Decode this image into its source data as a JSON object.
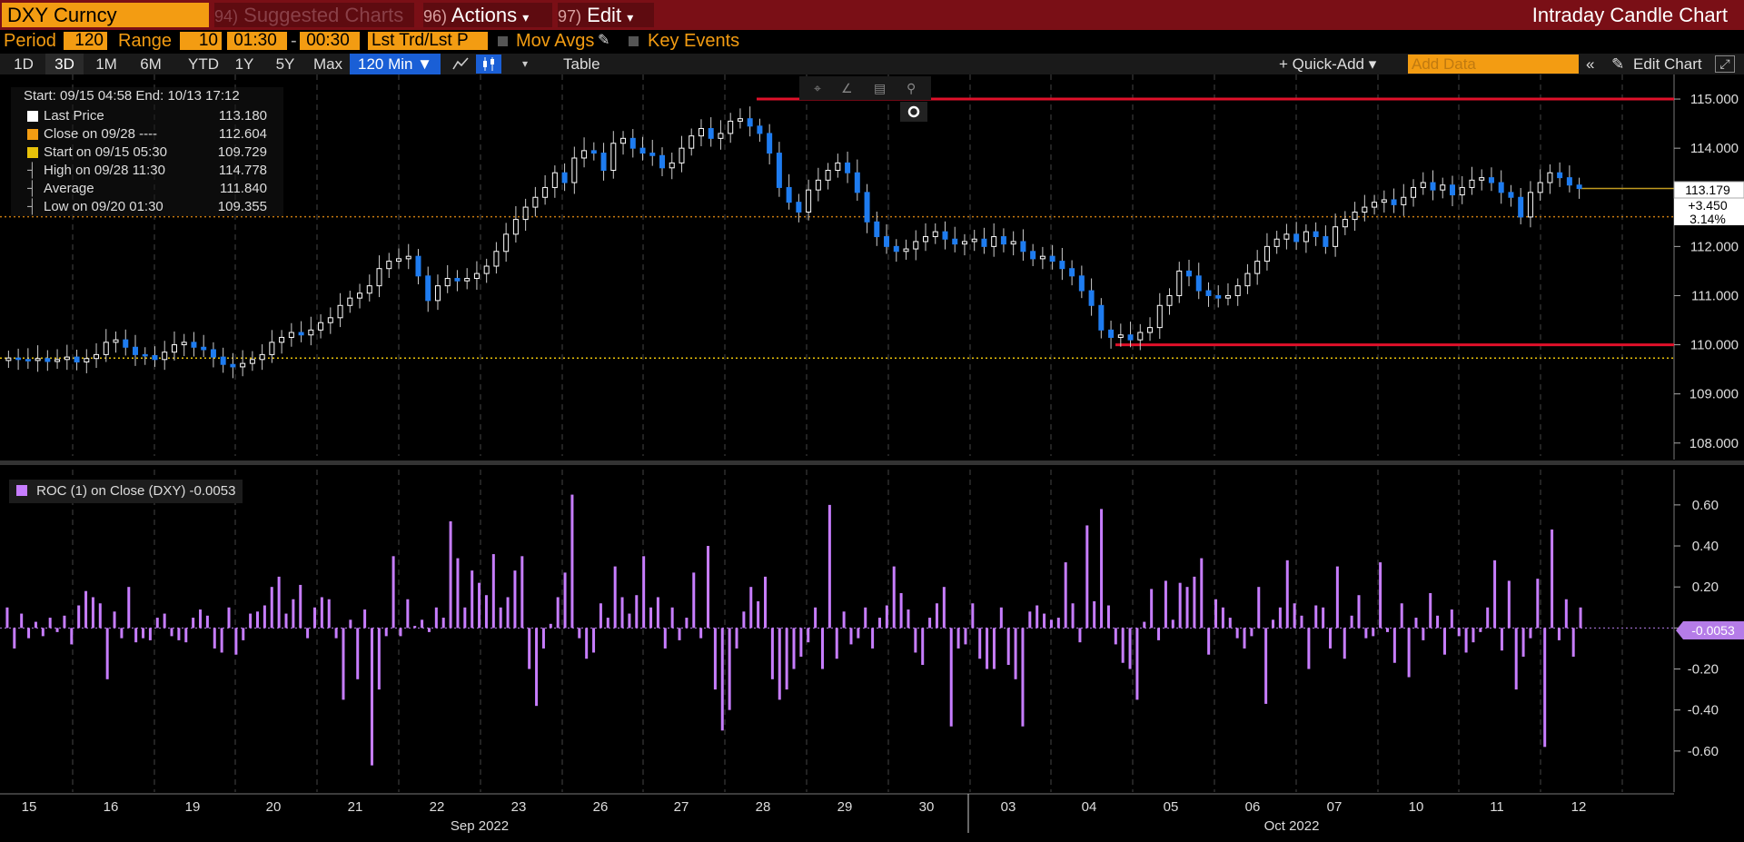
{
  "toolbar": {
    "ticker": "DXY Curncy",
    "suggested_num": "94)",
    "suggested_label": "Suggested Charts",
    "actions_num": "96)",
    "actions_label": "Actions",
    "edit_num": "97)",
    "edit_label": "Edit",
    "chart_title": "Intraday Candle Chart"
  },
  "settings": {
    "period_label": "Period",
    "period_value": "120",
    "range_label": "Range",
    "range_value": "10",
    "time_from": "01:30",
    "time_to": "00:30",
    "trade_mode": "Lst Trd/Lst P",
    "mov_avgs": "Mov Avgs",
    "key_events": "Key Events"
  },
  "ranges": [
    "1D",
    "3D",
    "1M",
    "6M",
    "YTD",
    "1Y",
    "5Y",
    "Max"
  ],
  "selected_range": "3D",
  "interval": "120 Min ▼",
  "table_label": "Table",
  "quick_add": "+ Quick-Add ▾",
  "add_data_placeholder": "Add Data",
  "edit_chart": "Edit Chart",
  "legend": {
    "range_line": "Start: 09/15 04:58 End: 10/13 17:12",
    "rows": [
      {
        "label": "Last Price",
        "value": "113.180",
        "color": "#ffffff"
      },
      {
        "label": "Close on 09/28 ----",
        "value": "112.604",
        "color": "#f39c12"
      },
      {
        "label": "Start on 09/15 05:30",
        "value": "109.729",
        "color": "#e8c20a"
      },
      {
        "label": "High on 09/28 11:30",
        "value": "114.778",
        "color": ""
      },
      {
        "label": "Average",
        "value": "111.840",
        "color": ""
      },
      {
        "label": "Low on 09/20 01:30",
        "value": "109.355",
        "color": ""
      }
    ]
  },
  "price_tag": {
    "value": "113.179",
    "change": "+3.450",
    "pct": "3.14%"
  },
  "roc_legend": "ROC (1)  on Close (DXY) -0.0053",
  "roc_tag": "-0.0053",
  "chart_data": [
    {
      "type": "candlestick",
      "y_ticks": [
        "115.000",
        "114.000",
        "113.000",
        "112.000",
        "111.000",
        "110.000",
        "109.000",
        "108.000"
      ],
      "ylim": [
        107.7,
        115.5
      ],
      "days": [
        "15",
        "16",
        "19",
        "20",
        "21",
        "22",
        "23",
        "26",
        "27",
        "28",
        "29",
        "30",
        "03",
        "04",
        "05",
        "06",
        "07",
        "10",
        "11",
        "12"
      ],
      "month_labels": [
        "Sep 2022",
        "Oct 2022"
      ],
      "reference_lines": {
        "resistance": 115.0,
        "support": 110.0,
        "close_0928": 112.604,
        "start": 109.729,
        "last": 113.18
      },
      "close_series": [
        109.73,
        109.7,
        109.68,
        109.72,
        109.66,
        109.7,
        109.75,
        109.65,
        109.72,
        109.8,
        110.05,
        110.1,
        109.95,
        109.8,
        109.78,
        109.7,
        109.85,
        110.0,
        110.05,
        109.95,
        109.9,
        109.75,
        109.6,
        109.55,
        109.62,
        109.7,
        109.8,
        110.05,
        110.15,
        110.25,
        110.2,
        110.3,
        110.45,
        110.55,
        110.8,
        110.95,
        111.05,
        111.2,
        111.55,
        111.7,
        111.75,
        111.8,
        111.4,
        110.9,
        111.2,
        111.35,
        111.3,
        111.35,
        111.45,
        111.6,
        111.9,
        112.25,
        112.55,
        112.8,
        113.0,
        113.2,
        113.5,
        113.3,
        113.8,
        113.95,
        113.9,
        113.55,
        114.1,
        114.2,
        114.0,
        113.9,
        113.85,
        113.6,
        113.7,
        114.0,
        114.25,
        114.4,
        114.2,
        114.3,
        114.55,
        114.6,
        114.45,
        114.3,
        113.9,
        113.2,
        112.9,
        112.7,
        113.15,
        113.35,
        113.55,
        113.7,
        113.5,
        113.1,
        112.5,
        112.2,
        112.0,
        111.9,
        111.95,
        112.1,
        112.2,
        112.3,
        112.15,
        112.05,
        112.1,
        112.15,
        112.0,
        112.2,
        112.05,
        112.1,
        111.9,
        111.75,
        111.8,
        111.7,
        111.55,
        111.4,
        111.1,
        110.8,
        110.3,
        110.15,
        110.2,
        110.1,
        110.25,
        110.35,
        110.8,
        111.0,
        111.5,
        111.4,
        111.1,
        111.0,
        110.95,
        111.0,
        111.2,
        111.45,
        111.7,
        112.0,
        112.15,
        112.25,
        112.1,
        112.3,
        112.2,
        112.0,
        112.4,
        112.55,
        112.7,
        112.8,
        112.9,
        112.95,
        112.85,
        113.0,
        113.2,
        113.3,
        113.15,
        113.25,
        113.05,
        113.2,
        113.35,
        113.4,
        113.3,
        113.1,
        113.0,
        112.6,
        113.1,
        113.3,
        113.5,
        113.4,
        113.25,
        113.18
      ]
    },
    {
      "type": "bar",
      "name": "ROC (1) on Close (DXY)",
      "y_ticks": [
        "0.60",
        "0.40",
        "0.20",
        "0.00",
        "-0.20",
        "-0.40",
        "-0.60"
      ],
      "ylim": [
        -0.8,
        0.75
      ],
      "values": [
        0.1,
        -0.1,
        0.07,
        -0.05,
        0.03,
        -0.04,
        0.05,
        -0.02,
        0.06,
        -0.08,
        0.11,
        0.18,
        0.15,
        0.12,
        -0.25,
        0.08,
        -0.05,
        0.2,
        -0.07,
        -0.05,
        -0.06,
        0.05,
        0.07,
        -0.04,
        -0.06,
        -0.07,
        0.05,
        0.09,
        0.06,
        -0.1,
        -0.12,
        0.1,
        -0.13,
        -0.06,
        0.07,
        0.08,
        0.11,
        0.2,
        0.25,
        0.07,
        0.14,
        0.21,
        -0.05,
        0.1,
        0.15,
        0.14,
        -0.05,
        -0.35,
        0.04,
        -0.25,
        0.09,
        -0.67,
        -0.3,
        -0.04,
        0.35,
        -0.04,
        0.14,
        0.01,
        0.04,
        -0.02,
        0.1,
        0.05,
        0.52,
        0.34,
        0.1,
        0.28,
        0.22,
        0.16,
        0.36,
        0.1,
        0.15,
        0.28,
        0.35,
        -0.2,
        -0.38,
        -0.1,
        0.02,
        0.15,
        0.27,
        0.65,
        -0.05,
        -0.15,
        -0.12,
        0.12,
        0.05,
        0.3,
        0.15,
        0.07,
        0.16,
        0.35,
        0.1,
        0.15,
        -0.1,
        0.1,
        -0.06,
        0.05,
        0.27,
        -0.05,
        0.4,
        -0.3,
        -0.5,
        -0.4,
        -0.1,
        0.08,
        0.2,
        0.13,
        0.25,
        -0.25,
        -0.35,
        -0.3,
        -0.2,
        -0.14,
        -0.07,
        0.1,
        -0.2,
        0.6,
        -0.15,
        0.08,
        -0.08,
        -0.05,
        0.1,
        -0.1,
        0.05,
        0.11,
        0.3,
        0.17,
        0.09,
        -0.12,
        -0.18,
        0.05,
        0.12,
        0.2,
        -0.48,
        -0.1,
        -0.08,
        0.12,
        -0.15,
        -0.2,
        -0.2,
        0.1,
        -0.18,
        -0.25,
        -0.48,
        0.08,
        0.11,
        0.07,
        0.04,
        0.05,
        0.32,
        0.12,
        -0.07,
        0.5,
        0.13,
        0.58,
        0.11,
        -0.08,
        -0.17,
        -0.2,
        -0.35,
        0.03,
        0.19,
        -0.06,
        0.23,
        0.04,
        0.22,
        0.2,
        0.25,
        0.34,
        -0.13,
        0.14,
        0.1,
        0.05,
        -0.05,
        -0.1,
        -0.04,
        0.2,
        -0.37,
        0.04,
        0.1,
        0.33,
        0.12,
        0.06,
        -0.2,
        0.11,
        0.1,
        -0.1,
        0.3,
        -0.15,
        0.06,
        0.16,
        -0.05,
        -0.04,
        0.32,
        -0.02,
        -0.17,
        0.12,
        -0.24,
        0.05,
        -0.06,
        0.17,
        0.06,
        -0.13,
        0.09,
        -0.04,
        -0.12,
        -0.07,
        -0.02,
        0.1,
        0.33,
        -0.11,
        0.23,
        -0.3,
        -0.14,
        -0.05,
        0.24,
        -0.58,
        0.48,
        -0.06,
        0.14,
        -0.14,
        0.1
      ]
    }
  ]
}
